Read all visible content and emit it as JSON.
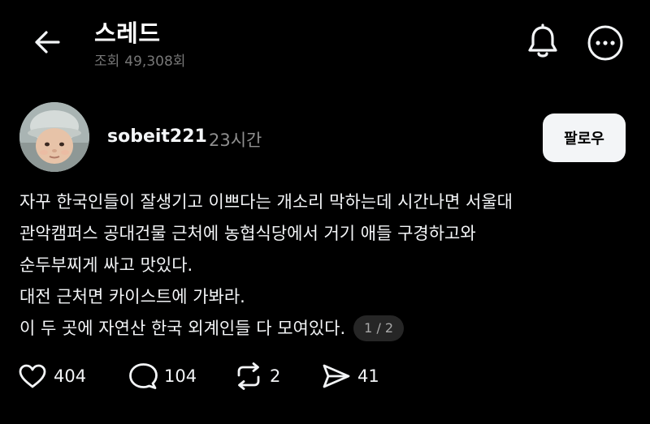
{
  "header": {
    "title": "스레드",
    "views_label": "조회",
    "views_count": "49,308회"
  },
  "post": {
    "username": "sobeit221",
    "time_ago": "23시간",
    "follow_label": "팔로우",
    "lines": [
      "자꾸 한국인들이 잘생기고 이쁘다는 개소리 막하는데 시간나면 서울대",
      "관악캠퍼스 공대건물 근처에 농협식당에서 거기 애들 구경하고와",
      "순두부찌게 싸고 맛있다.",
      "대전 근처면 카이스트에 가봐라.",
      "이 두 곳에 자연산 한국 외계인들 다 모여있다."
    ],
    "page_indicator": "1 / 2"
  },
  "actions": {
    "like_count": "404",
    "reply_count": "104",
    "repost_count": "2",
    "share_count": "41"
  },
  "icons": {
    "back": "arrow-left-icon",
    "notifications": "bell-icon",
    "more": "more-horizontal-icon",
    "like": "heart-icon",
    "reply": "comment-bubble-icon",
    "repost": "repost-icon",
    "share": "send-icon"
  }
}
